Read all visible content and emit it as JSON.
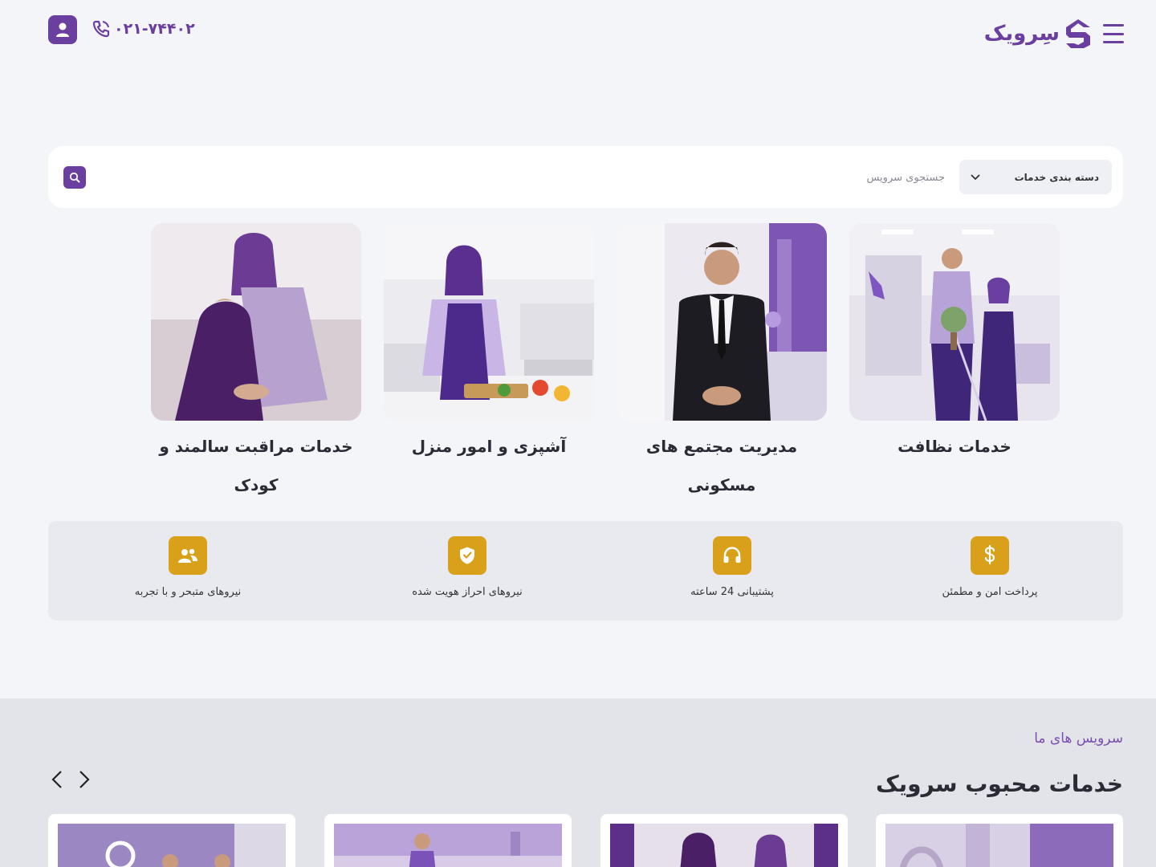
{
  "header": {
    "logo_text": "سِرویک",
    "phone": "۰۲۱-۷۴۴۰۲"
  },
  "search": {
    "category_label": "دسته بندی خدمات",
    "placeholder": "جستجوی سرویس"
  },
  "services": [
    {
      "title": "خدمات نظافت"
    },
    {
      "title": "مدیریت مجتمع های مسکونی"
    },
    {
      "title": "آشپزی و امور منزل"
    },
    {
      "title": "خدمات مراقبت سالمند و کودک"
    }
  ],
  "features": [
    {
      "label": "پرداخت امن و مطمئن",
      "icon": "dollar-icon"
    },
    {
      "label": "پشتیبانی 24 ساعته",
      "icon": "headset-icon"
    },
    {
      "label": "نیروهای احراز هویت شده",
      "icon": "shield-check-icon"
    },
    {
      "label": "نیروهای متبحر و با تجربه",
      "icon": "users-icon"
    }
  ],
  "popular": {
    "kicker": "سرویس های ما",
    "heading": "خدمات محبوب سرویک"
  },
  "colors": {
    "brand": "#6b3fa0",
    "accent": "#d9a11a",
    "background": "#f4f5f8"
  }
}
